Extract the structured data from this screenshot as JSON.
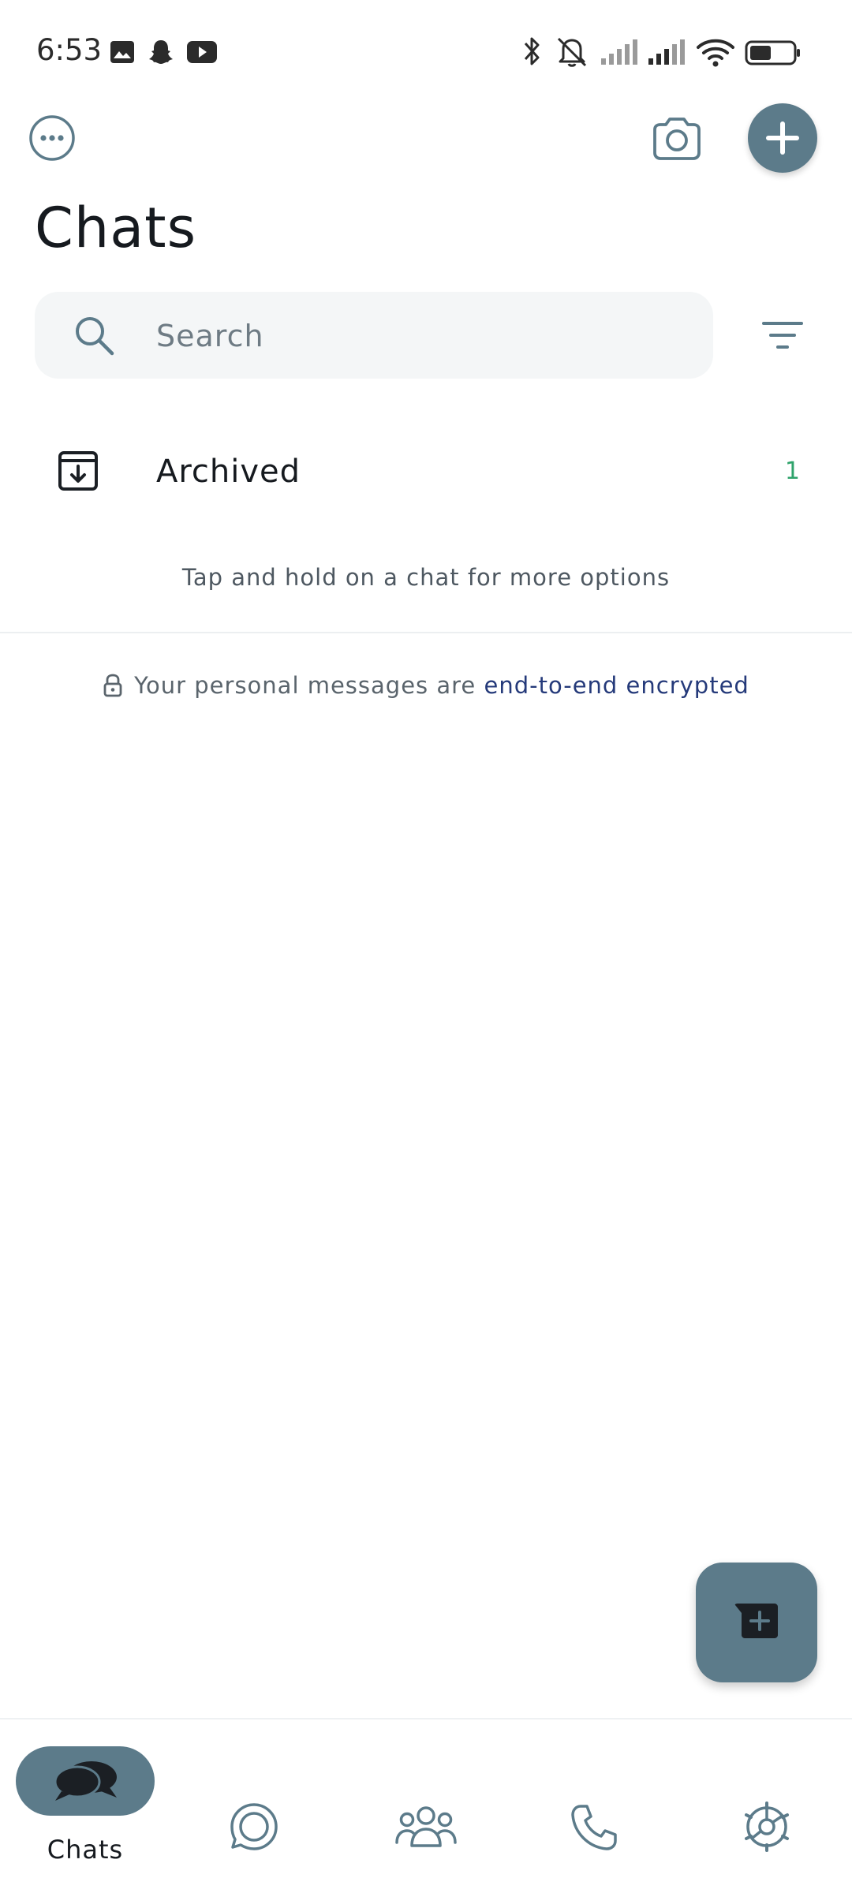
{
  "status_bar": {
    "time": "6:53",
    "notification_icons": [
      "gallery-icon",
      "snapchat-icon",
      "youtube-icon"
    ],
    "system_icons": [
      "bluetooth-icon",
      "mute-icon",
      "signal-icon",
      "signal-icon",
      "wifi-icon",
      "battery-icon"
    ]
  },
  "header": {
    "title": "Chats",
    "more_icon": "more-options-icon",
    "camera_icon": "camera-icon",
    "add_icon": "plus-icon"
  },
  "search": {
    "placeholder": "Search",
    "value": "",
    "filter_icon": "filter-icon"
  },
  "archived": {
    "label": "Archived",
    "count": "1",
    "icon": "archive-icon"
  },
  "hint": "Tap and hold on a chat for more options",
  "encryption": {
    "prefix": "Your personal messages are ",
    "link": "end-to-end encrypted",
    "icon": "lock-icon"
  },
  "fab": {
    "icon": "new-chat-icon"
  },
  "bottom_nav": {
    "items": [
      {
        "label": "Chats",
        "icon": "chats-icon",
        "active": true
      },
      {
        "label": "",
        "icon": "updates-icon",
        "active": false
      },
      {
        "label": "",
        "icon": "communities-icon",
        "active": false
      },
      {
        "label": "",
        "icon": "calls-icon",
        "active": false
      },
      {
        "label": "",
        "icon": "settings-icon",
        "active": false
      }
    ]
  },
  "colors": {
    "accent": "#5c7b8a",
    "count_green": "#2fa36b",
    "link_blue": "#253a7a",
    "search_bg": "#f4f6f7"
  }
}
